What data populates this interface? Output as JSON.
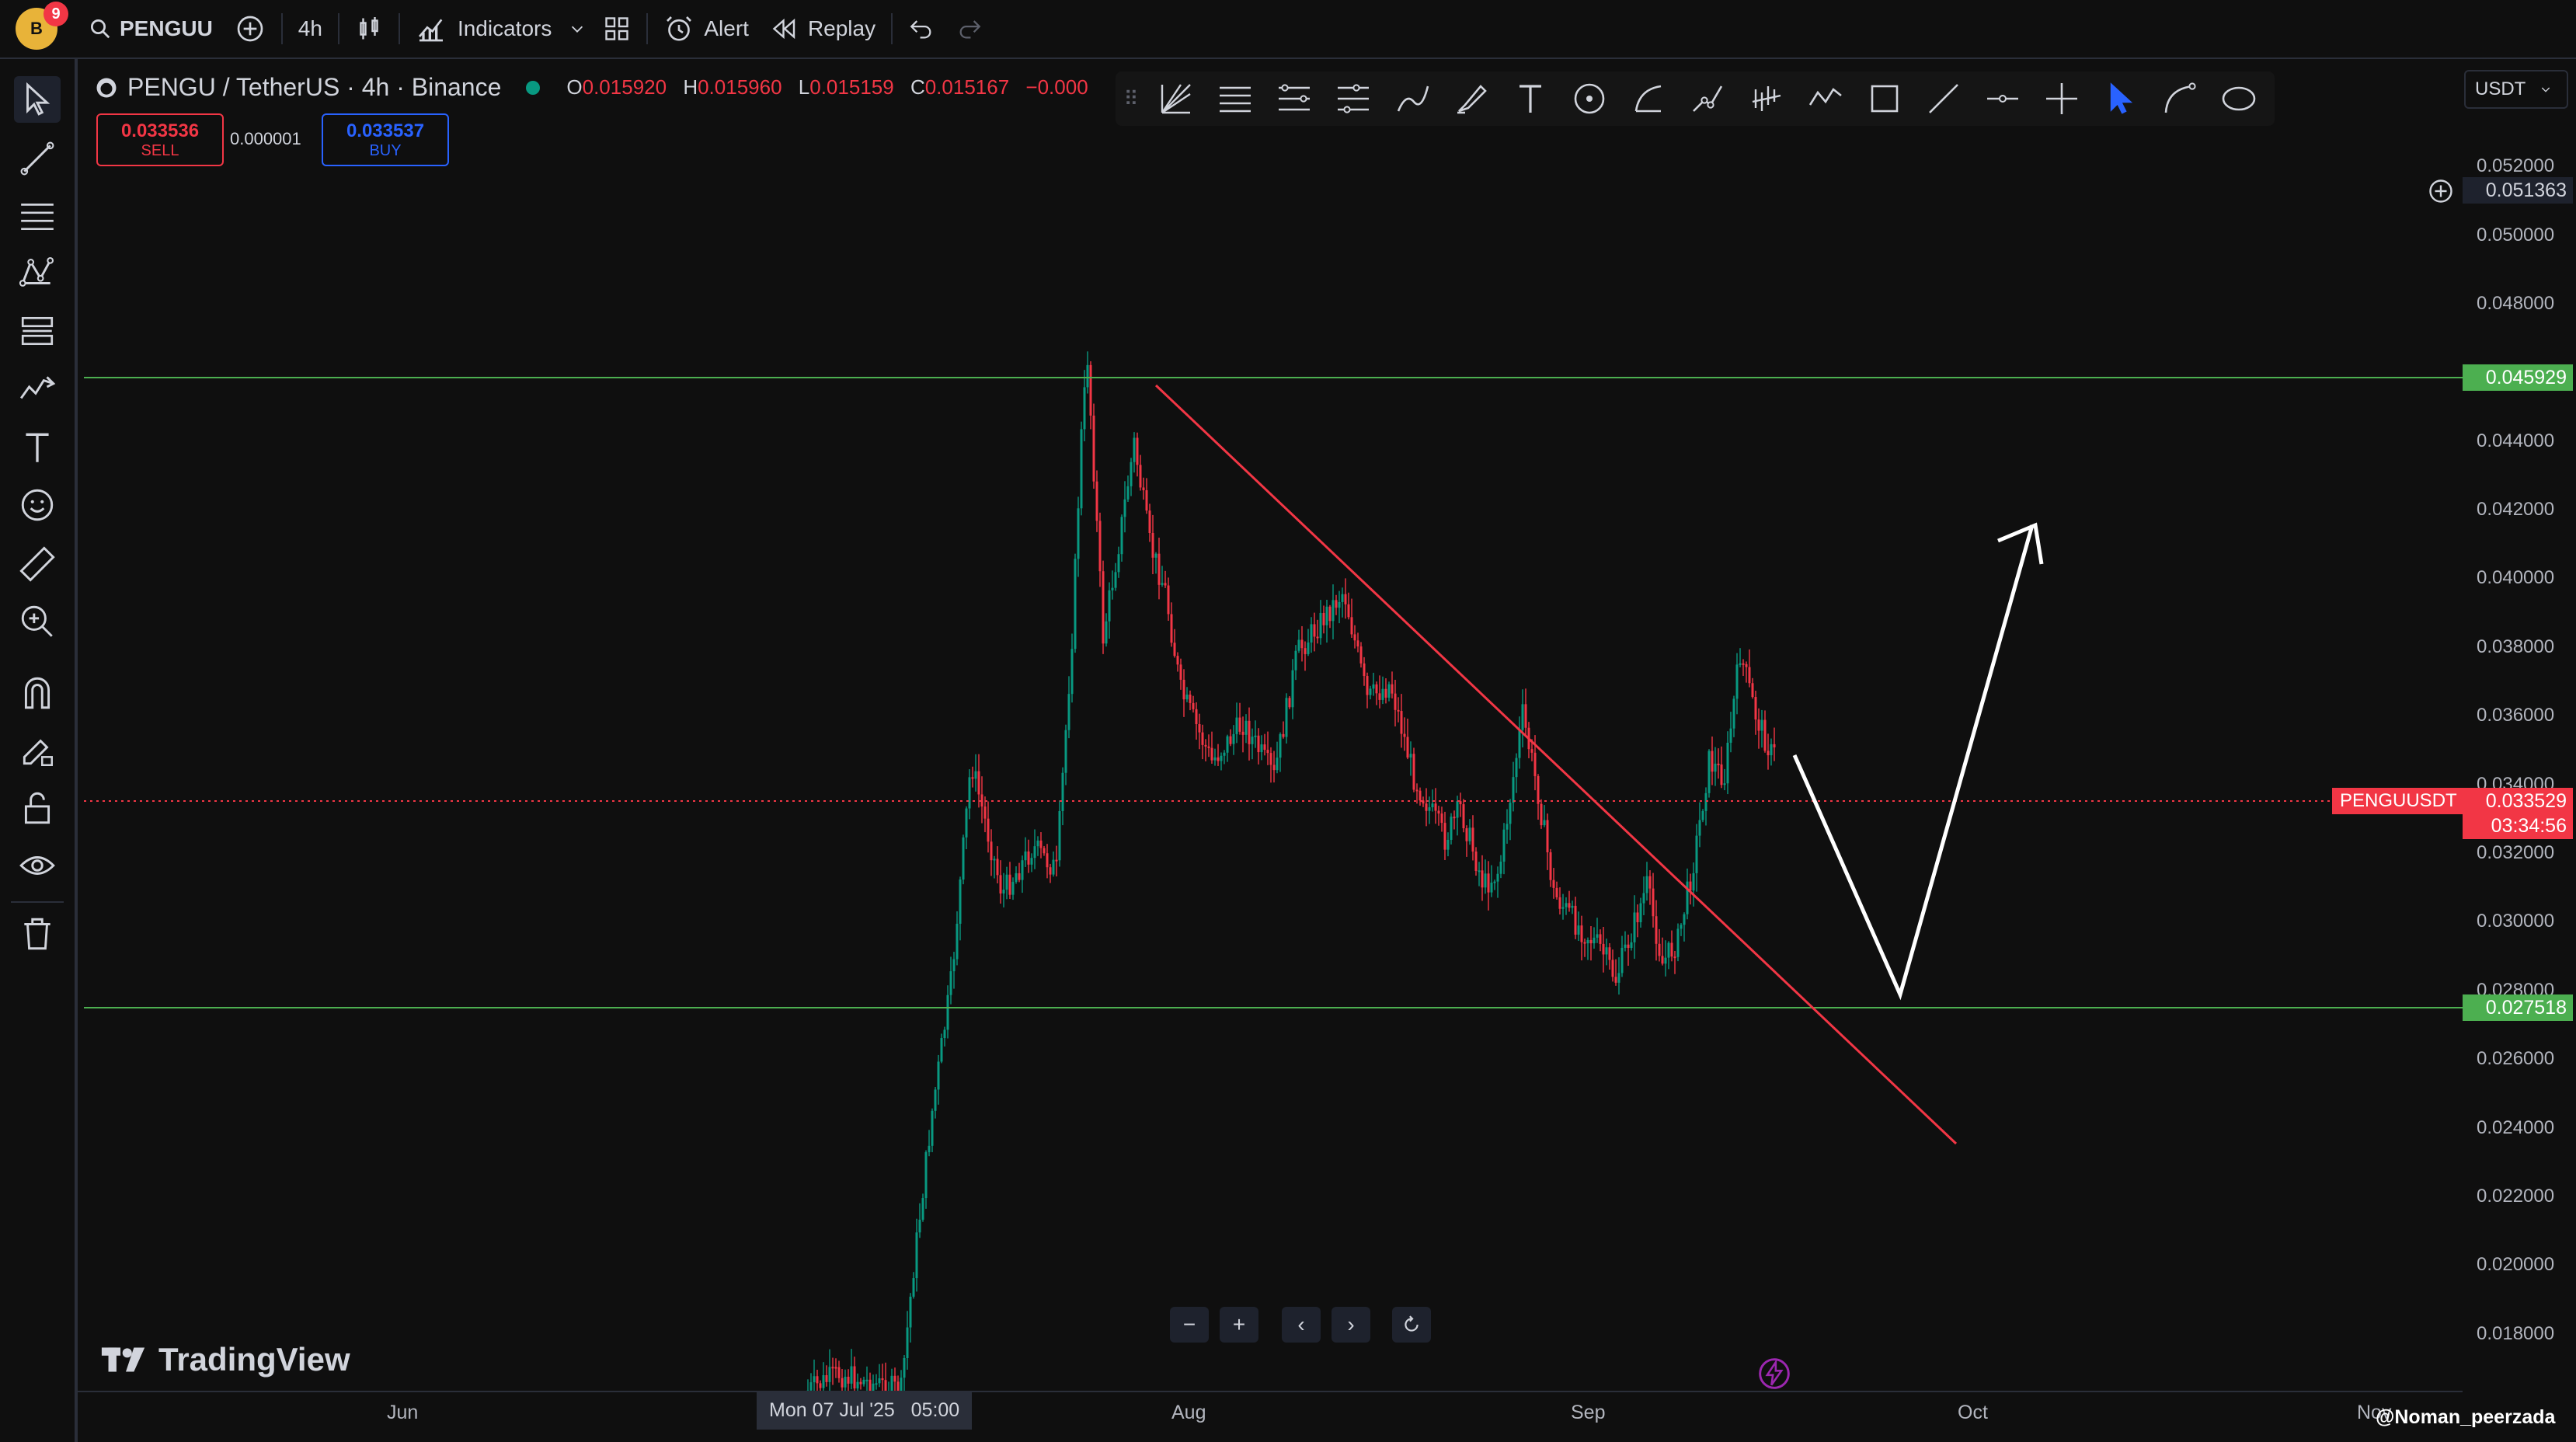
{
  "topbar": {
    "notification_count": "9",
    "symbol": "PENGUU",
    "interval": "4h",
    "indicators_label": "Indicators",
    "alert_label": "Alert",
    "replay_label": "Replay"
  },
  "legend": {
    "title": "PENGU / TetherUS · 4h · Binance",
    "open_key": "O",
    "open": "0.015920",
    "high_key": "H",
    "high": "0.015960",
    "low_key": "L",
    "low": "0.015159",
    "close_key": "C",
    "close": "0.015167",
    "change": "−0.000"
  },
  "trade": {
    "sell_price": "0.033536",
    "sell_label": "SELL",
    "spread": "0.000001",
    "buy_price": "0.033537",
    "buy_label": "BUY"
  },
  "currency_select": "USDT",
  "price_axis": {
    "ticks": [
      "0.052000",
      "0.050000",
      "0.048000",
      "0.044000",
      "0.042000",
      "0.040000",
      "0.038000",
      "0.036000",
      "0.034000",
      "0.032000",
      "0.030000",
      "0.028000",
      "0.026000",
      "0.024000",
      "0.022000",
      "0.020000",
      "0.018000"
    ],
    "crosshair_price": "0.051363",
    "resistance_price": "0.045929",
    "support_price": "0.027518",
    "last_symbol": "PENGUUSDT",
    "last_price": "0.033529",
    "countdown": "03:34:56"
  },
  "time_axis": {
    "labels": [
      "Jun",
      "Aug",
      "Sep",
      "Oct",
      "Nov"
    ],
    "crosshair_time": "Mon 07 Jul '25   05:00"
  },
  "watermark": "TradingView",
  "credit": "@Noman_peerzada",
  "colors": {
    "up": "#089981",
    "down": "#f23645",
    "level": "#4caf50",
    "trendline": "#f23645",
    "projection": "#ffffff"
  }
}
